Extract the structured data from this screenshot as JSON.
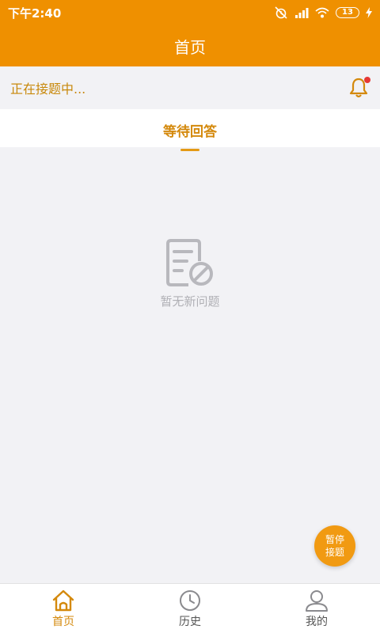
{
  "status_bar": {
    "time": "下午2:40",
    "battery": "13",
    "icons": [
      "alarm-off-icon",
      "signal-icon",
      "wifi-icon",
      "battery-icon",
      "charging-icon"
    ]
  },
  "app_bar": {
    "title": "首页"
  },
  "status_row": {
    "text": "正在接题中...",
    "icon": "bell-icon"
  },
  "tabs": [
    {
      "label": "等待回答",
      "active": true
    }
  ],
  "empty_state": {
    "text": "暂无新问题",
    "icon": "no-document-icon"
  },
  "fab": {
    "line1": "暂停",
    "line2": "接题"
  },
  "bottom_nav": {
    "items": [
      {
        "label": "首页",
        "icon": "home-icon",
        "active": true
      },
      {
        "label": "历史",
        "icon": "clock-icon",
        "active": false
      },
      {
        "label": "我的",
        "icon": "user-icon",
        "active": false
      }
    ]
  },
  "colors": {
    "primary": "#ef9000",
    "accent_text": "#d4890c",
    "background": "#f2f2f5",
    "badge": "#e53935"
  }
}
